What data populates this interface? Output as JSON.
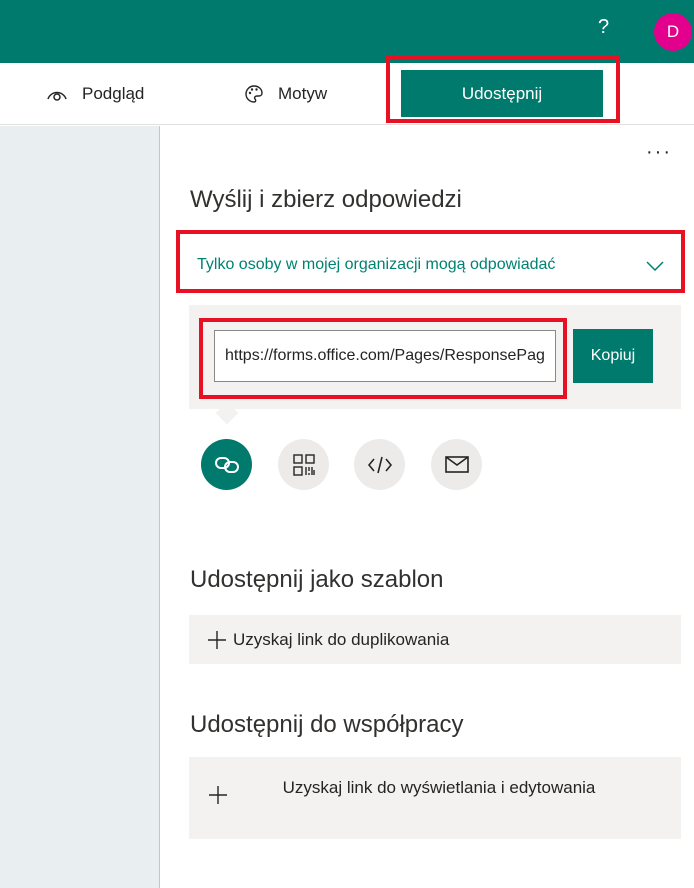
{
  "topbar": {
    "help_label": "?",
    "avatar_initial": "D",
    "avatar_color": "#e3008c",
    "brand_color": "#007a6c"
  },
  "commandbar": {
    "preview_label": "Podgląd",
    "preview_icon": "eye-icon",
    "theme_label": "Motyw",
    "theme_icon": "palette-icon",
    "share_label": "Udostępnij",
    "more_label": "···"
  },
  "send_section": {
    "title": "Wyślij i zbierz odpowiedzi",
    "permission_label": "Tylko osoby w mojej organizacji mogą odpowiadać",
    "url_value": "https://forms.office.com/Pages/ResponsePage.aspx",
    "copy_label": "Kopiuj",
    "share_options": [
      "link-icon",
      "qr-code-icon",
      "embed-code-icon",
      "email-icon"
    ]
  },
  "template_section": {
    "title": "Udostępnij jako szablon",
    "button_label": "Uzyskaj link do duplikowania"
  },
  "collab_section": {
    "title": "Udostępnij do współpracy",
    "button_label": "Uzyskaj link do wyświetlania i edytowania"
  },
  "highlight_color": "#e81123"
}
